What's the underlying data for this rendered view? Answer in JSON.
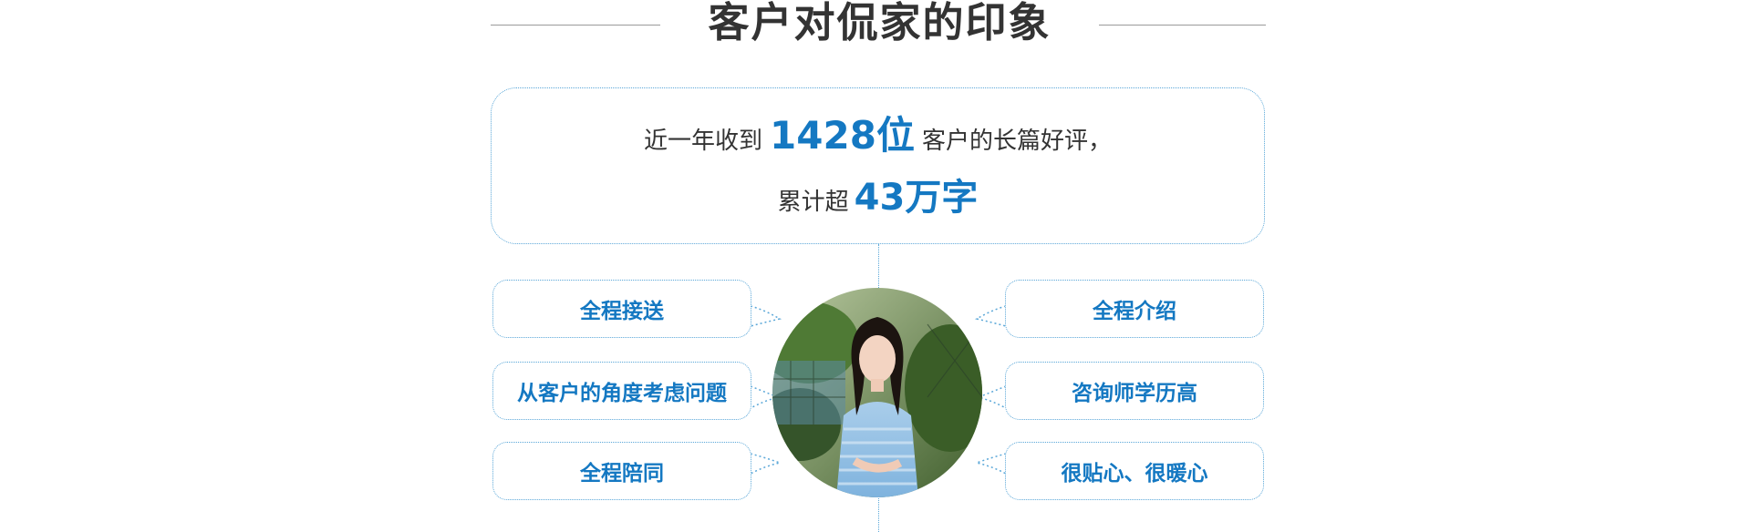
{
  "header": {
    "title": "客户对侃家的印象"
  },
  "summary": {
    "line1_prefix": "近一年收到",
    "line1_number": "1428位",
    "line1_suffix": "客户的长篇好评，",
    "line2_prefix": "累计超",
    "line2_number": "43万字"
  },
  "comments_left": [
    "全程接送",
    "从客户的角度考虑问题",
    "全程陪同"
  ],
  "comments_right": [
    "全程介绍",
    "咨询师学历高",
    "很贴心、很暖心"
  ],
  "colors": {
    "accent": "#1478c2",
    "border": "#5aa7d8",
    "title": "#333333"
  },
  "image": {
    "subject": "customer-photo"
  }
}
